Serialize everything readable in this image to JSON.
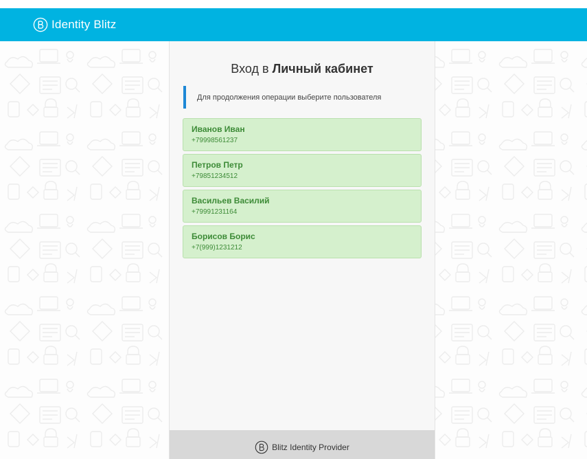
{
  "header": {
    "brand_name": "Identity Blitz",
    "logo_icon": "blitz-b-logo",
    "background_color": "#00b3e1"
  },
  "login": {
    "title_prefix": "Вход в ",
    "title_strong": "Личный кабинет",
    "hint": "Для продолжения операции выберите пользователя",
    "hint_accent_color": "#1e88d6"
  },
  "users": [
    {
      "name": "Иванов Иван",
      "phone": "+79998561237"
    },
    {
      "name": "Петров Петр",
      "phone": "+79851234512"
    },
    {
      "name": "Васильев Василий",
      "phone": "+79991231164"
    },
    {
      "name": "Борисов Борис",
      "phone": "+7(999)1231212"
    }
  ],
  "footer": {
    "label": "Blitz Identity Provider",
    "logo_icon": "blitz-b-logo"
  },
  "colors": {
    "card_background": "#d5f0cd",
    "card_text": "#3d8b37"
  }
}
